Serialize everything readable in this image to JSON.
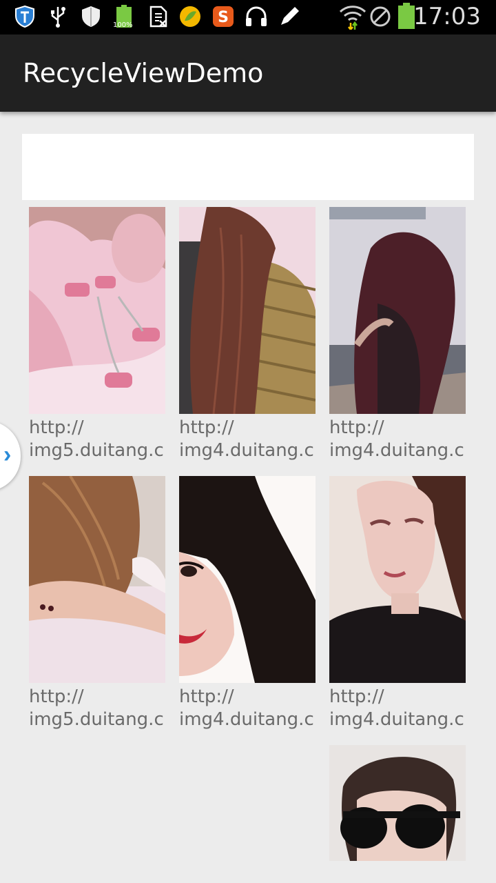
{
  "status_bar": {
    "time": "17:03",
    "battery_left_label": "100%",
    "icons": [
      "shield-icon",
      "usb-icon",
      "security-icon",
      "battery-full-icon",
      "sim-icon",
      "lemon-app-icon",
      "sogou-icon",
      "headphones-icon",
      "pencil-icon",
      "wifi-icon",
      "block-icon",
      "battery-icon"
    ]
  },
  "app_bar": {
    "title": "RecycleViewDemo"
  },
  "grid": {
    "items": [
      {
        "caption": "http://\nimg5.duitang.c",
        "palette": [
          "#f4c8d8",
          "#e8a8bb",
          "#b06070"
        ]
      },
      {
        "caption": "http://\nimg4.duitang.c",
        "palette": [
          "#f0d8e0",
          "#7a4b3b",
          "#a78a50"
        ]
      },
      {
        "caption": "http://\nimg4.duitang.c",
        "palette": [
          "#dcd8e0",
          "#5b2a33",
          "#8a6a60"
        ]
      },
      {
        "caption": "http://\nimg5.duitang.c",
        "palette": [
          "#f0e4ea",
          "#8a5a3e",
          "#e8c0b0"
        ]
      },
      {
        "caption": "http://\nimg4.duitang.c",
        "palette": [
          "#fbf7f5",
          "#1a1210",
          "#c83040"
        ]
      },
      {
        "caption": "http://\nimg4.duitang.c",
        "palette": [
          "#efe6e2",
          "#4a2a25",
          "#1a1518"
        ]
      },
      {
        "caption": "",
        "palette": [
          "#e6e2e0",
          "#3a2a28",
          "#1a1a1a"
        ]
      }
    ]
  }
}
